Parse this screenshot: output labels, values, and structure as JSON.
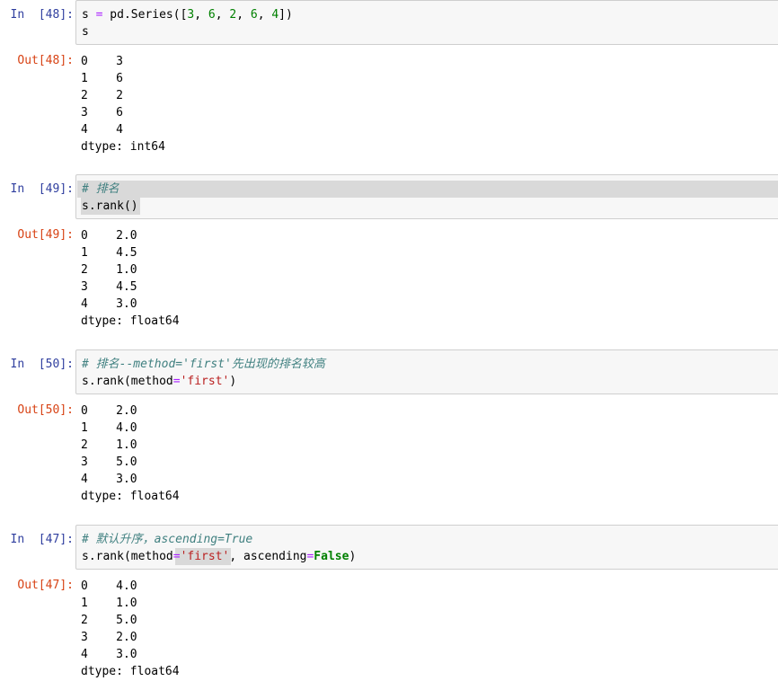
{
  "cells": [
    {
      "in_prompt": "In  [48]:",
      "out_prompt": "Out[48]:",
      "code": {
        "line1": {
          "a": "s ",
          "eq": "=",
          "b": " pd.Series([",
          "n1": "3",
          "c1": ", ",
          "n2": "6",
          "c2": ", ",
          "n3": "2",
          "c3": ", ",
          "n4": "6",
          "c4": ", ",
          "n5": "4",
          "end": "])"
        },
        "line2": "s"
      },
      "output": [
        {
          "idx": "0",
          "val": "3"
        },
        {
          "idx": "1",
          "val": "6"
        },
        {
          "idx": "2",
          "val": "2"
        },
        {
          "idx": "3",
          "val": "6"
        },
        {
          "idx": "4",
          "val": "4"
        }
      ],
      "dtype": "dtype: int64"
    },
    {
      "in_prompt": "In  [49]:",
      "out_prompt": "Out[49]:",
      "code": {
        "comment": "# 排名",
        "line2": "s.rank()"
      },
      "output": [
        {
          "idx": "0",
          "val": "2.0"
        },
        {
          "idx": "1",
          "val": "4.5"
        },
        {
          "idx": "2",
          "val": "1.0"
        },
        {
          "idx": "3",
          "val": "4.5"
        },
        {
          "idx": "4",
          "val": "3.0"
        }
      ],
      "dtype": "dtype: float64"
    },
    {
      "in_prompt": "In  [50]:",
      "out_prompt": "Out[50]:",
      "code": {
        "comment": "# 排名--method='first'先出现的排名较高",
        "l2a": "s.rank(method",
        "l2eq": "=",
        "l2str": "'first'",
        "l2end": ")"
      },
      "output": [
        {
          "idx": "0",
          "val": "2.0"
        },
        {
          "idx": "1",
          "val": "4.0"
        },
        {
          "idx": "2",
          "val": "1.0"
        },
        {
          "idx": "3",
          "val": "5.0"
        },
        {
          "idx": "4",
          "val": "3.0"
        }
      ],
      "dtype": "dtype: float64"
    },
    {
      "in_prompt": "In  [47]:",
      "out_prompt": "Out[47]:",
      "code": {
        "comment": "# 默认升序，ascending=True",
        "l2a": "s.rank(method",
        "l2eq": "=",
        "l2str": "'first'",
        "l2b": ", ascending",
        "l2eq2": "=",
        "l2kw": "False",
        "l2end": ")"
      },
      "output": [
        {
          "idx": "0",
          "val": "4.0"
        },
        {
          "idx": "1",
          "val": "1.0"
        },
        {
          "idx": "2",
          "val": "5.0"
        },
        {
          "idx": "3",
          "val": "2.0"
        },
        {
          "idx": "4",
          "val": "3.0"
        }
      ],
      "dtype": "dtype: float64"
    }
  ]
}
